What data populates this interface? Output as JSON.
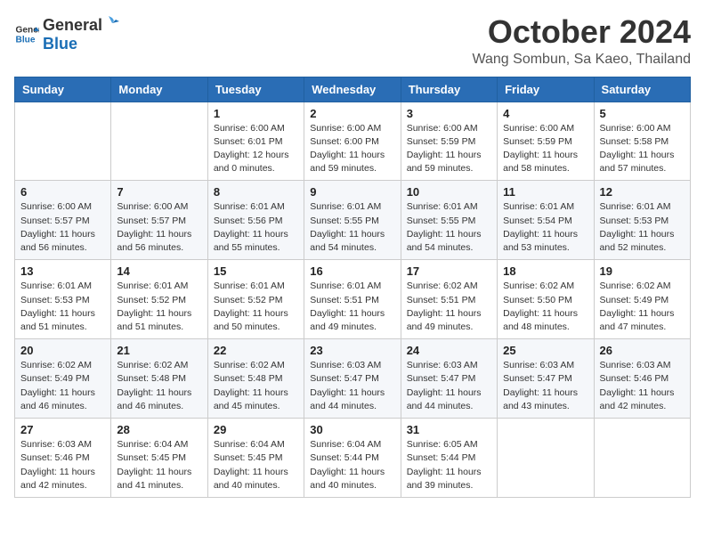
{
  "logo": {
    "general": "General",
    "blue": "Blue"
  },
  "title": {
    "month": "October 2024",
    "location": "Wang Sombun, Sa Kaeo, Thailand"
  },
  "weekdays": [
    "Sunday",
    "Monday",
    "Tuesday",
    "Wednesday",
    "Thursday",
    "Friday",
    "Saturday"
  ],
  "weeks": [
    [
      {
        "day": "",
        "info": ""
      },
      {
        "day": "",
        "info": ""
      },
      {
        "day": "1",
        "info": "Sunrise: 6:00 AM\nSunset: 6:01 PM\nDaylight: 12 hours\nand 0 minutes."
      },
      {
        "day": "2",
        "info": "Sunrise: 6:00 AM\nSunset: 6:00 PM\nDaylight: 11 hours\nand 59 minutes."
      },
      {
        "day": "3",
        "info": "Sunrise: 6:00 AM\nSunset: 5:59 PM\nDaylight: 11 hours\nand 59 minutes."
      },
      {
        "day": "4",
        "info": "Sunrise: 6:00 AM\nSunset: 5:59 PM\nDaylight: 11 hours\nand 58 minutes."
      },
      {
        "day": "5",
        "info": "Sunrise: 6:00 AM\nSunset: 5:58 PM\nDaylight: 11 hours\nand 57 minutes."
      }
    ],
    [
      {
        "day": "6",
        "info": "Sunrise: 6:00 AM\nSunset: 5:57 PM\nDaylight: 11 hours\nand 56 minutes."
      },
      {
        "day": "7",
        "info": "Sunrise: 6:00 AM\nSunset: 5:57 PM\nDaylight: 11 hours\nand 56 minutes."
      },
      {
        "day": "8",
        "info": "Sunrise: 6:01 AM\nSunset: 5:56 PM\nDaylight: 11 hours\nand 55 minutes."
      },
      {
        "day": "9",
        "info": "Sunrise: 6:01 AM\nSunset: 5:55 PM\nDaylight: 11 hours\nand 54 minutes."
      },
      {
        "day": "10",
        "info": "Sunrise: 6:01 AM\nSunset: 5:55 PM\nDaylight: 11 hours\nand 54 minutes."
      },
      {
        "day": "11",
        "info": "Sunrise: 6:01 AM\nSunset: 5:54 PM\nDaylight: 11 hours\nand 53 minutes."
      },
      {
        "day": "12",
        "info": "Sunrise: 6:01 AM\nSunset: 5:53 PM\nDaylight: 11 hours\nand 52 minutes."
      }
    ],
    [
      {
        "day": "13",
        "info": "Sunrise: 6:01 AM\nSunset: 5:53 PM\nDaylight: 11 hours\nand 51 minutes."
      },
      {
        "day": "14",
        "info": "Sunrise: 6:01 AM\nSunset: 5:52 PM\nDaylight: 11 hours\nand 51 minutes."
      },
      {
        "day": "15",
        "info": "Sunrise: 6:01 AM\nSunset: 5:52 PM\nDaylight: 11 hours\nand 50 minutes."
      },
      {
        "day": "16",
        "info": "Sunrise: 6:01 AM\nSunset: 5:51 PM\nDaylight: 11 hours\nand 49 minutes."
      },
      {
        "day": "17",
        "info": "Sunrise: 6:02 AM\nSunset: 5:51 PM\nDaylight: 11 hours\nand 49 minutes."
      },
      {
        "day": "18",
        "info": "Sunrise: 6:02 AM\nSunset: 5:50 PM\nDaylight: 11 hours\nand 48 minutes."
      },
      {
        "day": "19",
        "info": "Sunrise: 6:02 AM\nSunset: 5:49 PM\nDaylight: 11 hours\nand 47 minutes."
      }
    ],
    [
      {
        "day": "20",
        "info": "Sunrise: 6:02 AM\nSunset: 5:49 PM\nDaylight: 11 hours\nand 46 minutes."
      },
      {
        "day": "21",
        "info": "Sunrise: 6:02 AM\nSunset: 5:48 PM\nDaylight: 11 hours\nand 46 minutes."
      },
      {
        "day": "22",
        "info": "Sunrise: 6:02 AM\nSunset: 5:48 PM\nDaylight: 11 hours\nand 45 minutes."
      },
      {
        "day": "23",
        "info": "Sunrise: 6:03 AM\nSunset: 5:47 PM\nDaylight: 11 hours\nand 44 minutes."
      },
      {
        "day": "24",
        "info": "Sunrise: 6:03 AM\nSunset: 5:47 PM\nDaylight: 11 hours\nand 44 minutes."
      },
      {
        "day": "25",
        "info": "Sunrise: 6:03 AM\nSunset: 5:47 PM\nDaylight: 11 hours\nand 43 minutes."
      },
      {
        "day": "26",
        "info": "Sunrise: 6:03 AM\nSunset: 5:46 PM\nDaylight: 11 hours\nand 42 minutes."
      }
    ],
    [
      {
        "day": "27",
        "info": "Sunrise: 6:03 AM\nSunset: 5:46 PM\nDaylight: 11 hours\nand 42 minutes."
      },
      {
        "day": "28",
        "info": "Sunrise: 6:04 AM\nSunset: 5:45 PM\nDaylight: 11 hours\nand 41 minutes."
      },
      {
        "day": "29",
        "info": "Sunrise: 6:04 AM\nSunset: 5:45 PM\nDaylight: 11 hours\nand 40 minutes."
      },
      {
        "day": "30",
        "info": "Sunrise: 6:04 AM\nSunset: 5:44 PM\nDaylight: 11 hours\nand 40 minutes."
      },
      {
        "day": "31",
        "info": "Sunrise: 6:05 AM\nSunset: 5:44 PM\nDaylight: 11 hours\nand 39 minutes."
      },
      {
        "day": "",
        "info": ""
      },
      {
        "day": "",
        "info": ""
      }
    ]
  ]
}
